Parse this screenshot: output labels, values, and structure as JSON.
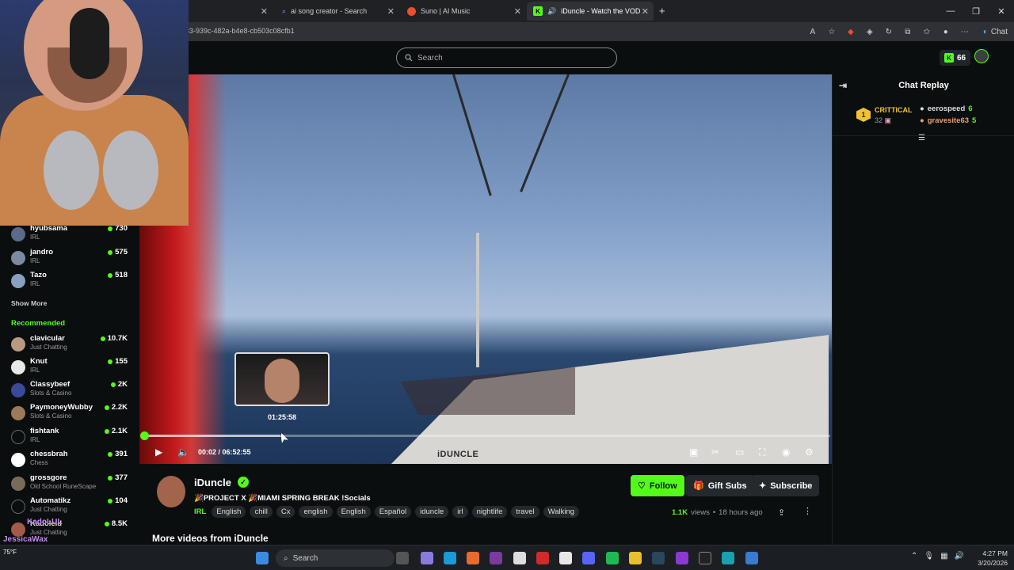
{
  "browser": {
    "tabs": [
      {
        "label": "ai song creator - Search"
      },
      {
        "label": "Suno | AI Music"
      },
      {
        "label": "iDuncle - Watch the VOD on K"
      }
    ],
    "url": "33-939c-482a-b4e8-cb503c08cfb1",
    "chat_button": "Chat"
  },
  "header": {
    "search_placeholder": "Search",
    "points": "66"
  },
  "sidebar": {
    "following": [
      {
        "name": "hyubsama",
        "category": "IRL",
        "viewers": "730",
        "avatar_color": "#5a6a8a"
      },
      {
        "name": "jandro",
        "category": "IRL",
        "viewers": "575",
        "avatar_color": "#7a8aa0"
      },
      {
        "name": "Tazo",
        "category": "IRL",
        "viewers": "518",
        "avatar_color": "#8aa0c0"
      }
    ],
    "show_more": "Show More",
    "recommended_title": "Recommended",
    "recommended": [
      {
        "name": "clavicular",
        "category": "Just Chatting",
        "viewers": "10.7K",
        "avatar_color": "#b89a80"
      },
      {
        "name": "Knut",
        "category": "IRL",
        "viewers": "155",
        "avatar_color": "#e8e8e8"
      },
      {
        "name": "Classybeef",
        "category": "Slots & Casino",
        "viewers": "2K",
        "avatar_color": "#3a4a9a"
      },
      {
        "name": "PaymoneyWubby",
        "category": "Slots & Casino",
        "viewers": "2.2K",
        "avatar_color": "#9a7a5a"
      },
      {
        "name": "fishtank",
        "category": "IRL",
        "viewers": "2.1K",
        "avatar_color": "#0b0e0f"
      },
      {
        "name": "chessbrah",
        "category": "Chess",
        "viewers": "391",
        "avatar_color": "#ffffff"
      },
      {
        "name": "grossgore",
        "category": "Old School RuneScape",
        "viewers": "377",
        "avatar_color": "#7a6a5a"
      },
      {
        "name": "Automatikz",
        "category": "Just Chatting",
        "viewers": "104",
        "avatar_color": "#0b0e0f"
      },
      {
        "name": "Kadoleld",
        "category": "Just Chatting",
        "viewers": "8.5K",
        "avatar_color": "#a35a4a"
      }
    ]
  },
  "player": {
    "preview_time": "01:25:58",
    "time": "00:02 / 06:52:55",
    "watermark": "iDUNCLE",
    "progress": 0.004,
    "hover_position": 0.207
  },
  "stream": {
    "name": "iDuncle",
    "title": "🎉PROJECT X 🎉MIAMI SPRING BREAK !Socials",
    "category": "IRL",
    "tags": [
      "English",
      "chill",
      "Cx",
      "english",
      "English",
      "Español",
      "iduncle",
      "irl",
      "nightlife",
      "travel",
      "Walking"
    ],
    "follow": "Follow",
    "gift": "Gift Subs",
    "subscribe": "Subscribe",
    "views_count": "1.1K",
    "views_label": "views",
    "age": "18 hours ago",
    "more_videos": "More videos from iDuncle"
  },
  "chat": {
    "title": "Chat Replay",
    "leader_rank": "1",
    "leader_name": "CRITTICAL",
    "leader_count": "32",
    "gifters": [
      {
        "name": "eerospeed",
        "count": "6"
      },
      {
        "name": "gravesite63",
        "count": "5"
      }
    ]
  },
  "overlay": {
    "line1": "KadoLUL",
    "line2": "JessicaWax"
  },
  "taskbar": {
    "search": "Search",
    "weather": "75°F",
    "time": "4:27 PM",
    "date": "3/20/2026"
  }
}
